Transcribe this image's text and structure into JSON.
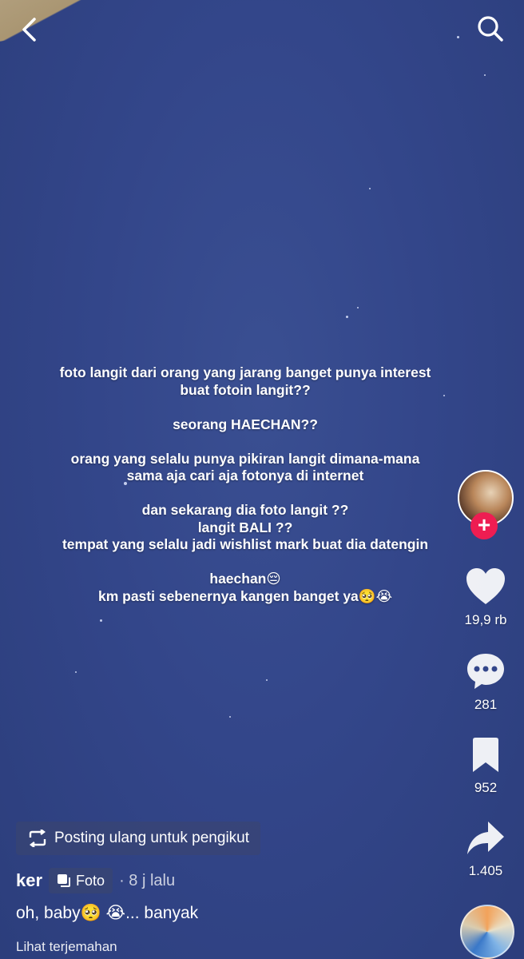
{
  "overlay": {
    "paragraphs": [
      "foto langit dari orang yang jarang banget punya interest\nbuat fotoin langit??",
      "seorang HAECHAN??",
      "orang yang selalu punya pikiran langit dimana-mana\nsama aja cari aja fotonya di internet",
      "dan sekarang dia foto langit ??\nlangit BALI ??\ntempat yang selalu jadi wishlist mark buat dia datengin",
      "haechan😔\nkm pasti sebenernya kangen banget ya🥺😭"
    ]
  },
  "actions": {
    "likes": "19,9 rb",
    "comments": "281",
    "saves": "952",
    "shares": "1.405"
  },
  "follow_symbol": "+",
  "repost_label": "Posting ulang untuk pengikut",
  "post": {
    "username": "ker",
    "type_label": "Foto",
    "time": "· 8 j lalu",
    "caption": "oh, baby🥺 😭... banyak",
    "translate_label": "Lihat terjemahan"
  },
  "icons": {
    "back": "back-chevron-icon",
    "search": "search-icon",
    "like": "heart-icon",
    "comment": "comment-bubble-icon",
    "save": "bookmark-icon",
    "share": "share-arrow-icon",
    "repost": "repost-icon",
    "photo": "photo-stack-icon"
  },
  "colors": {
    "background": "#33468a",
    "follow_badge": "#ee1d52"
  }
}
